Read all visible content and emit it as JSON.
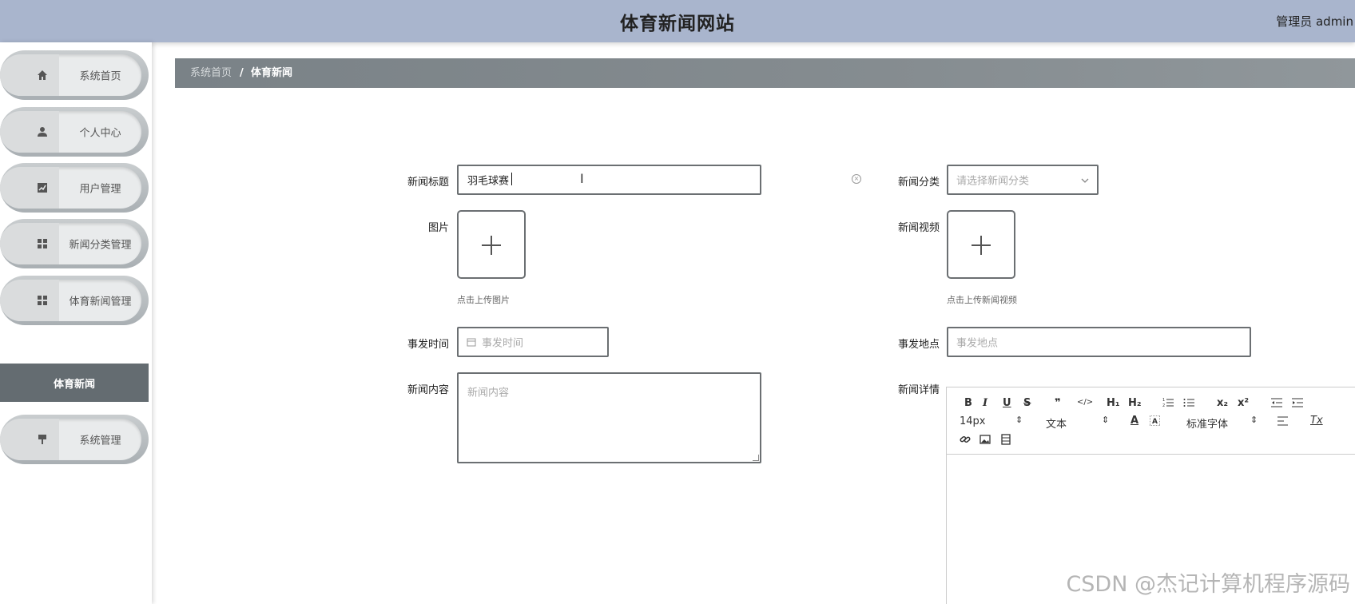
{
  "header": {
    "title": "体育新闻网站",
    "user": "管理员 admin"
  },
  "sidebar": {
    "items": [
      {
        "label": "系统首页",
        "icon": "home-icon"
      },
      {
        "label": "个人中心",
        "icon": "user-icon"
      },
      {
        "label": "用户管理",
        "icon": "chart-icon"
      },
      {
        "label": "新闻分类管理",
        "icon": "grid-icon"
      },
      {
        "label": "体育新闻管理",
        "icon": "grid-icon"
      },
      {
        "label": "系统管理",
        "icon": "brush-icon"
      }
    ],
    "submenu": {
      "label": "体育新闻"
    }
  },
  "breadcrumb": {
    "home": "系统首页",
    "separator": "/",
    "current": "体育新闻"
  },
  "form": {
    "title_label": "新闻标题",
    "title_value": "羽毛球赛",
    "category_label": "新闻分类",
    "category_placeholder": "请选择新闻分类",
    "image_label": "图片",
    "image_hint": "点击上传图片",
    "video_label": "新闻视频",
    "video_hint": "点击上传新闻视频",
    "time_label": "事发时间",
    "time_placeholder": "事发时间",
    "place_label": "事发地点",
    "place_placeholder": "事发地点",
    "content_label": "新闻内容",
    "content_placeholder": "新闻内容",
    "detail_label": "新闻详情"
  },
  "editor": {
    "font_size": "14px",
    "header_type": "文本",
    "font_family": "标准字体",
    "bold": "B",
    "italic": "I",
    "underline": "U",
    "strike": "S",
    "quote": "❞",
    "code": "</>",
    "h1": "H₁",
    "h2": "H₂",
    "sub": "x₂",
    "sup": "x²",
    "font_color": "A",
    "clear": "Tx"
  },
  "watermark": "CSDN @杰记计算机程序源码"
}
